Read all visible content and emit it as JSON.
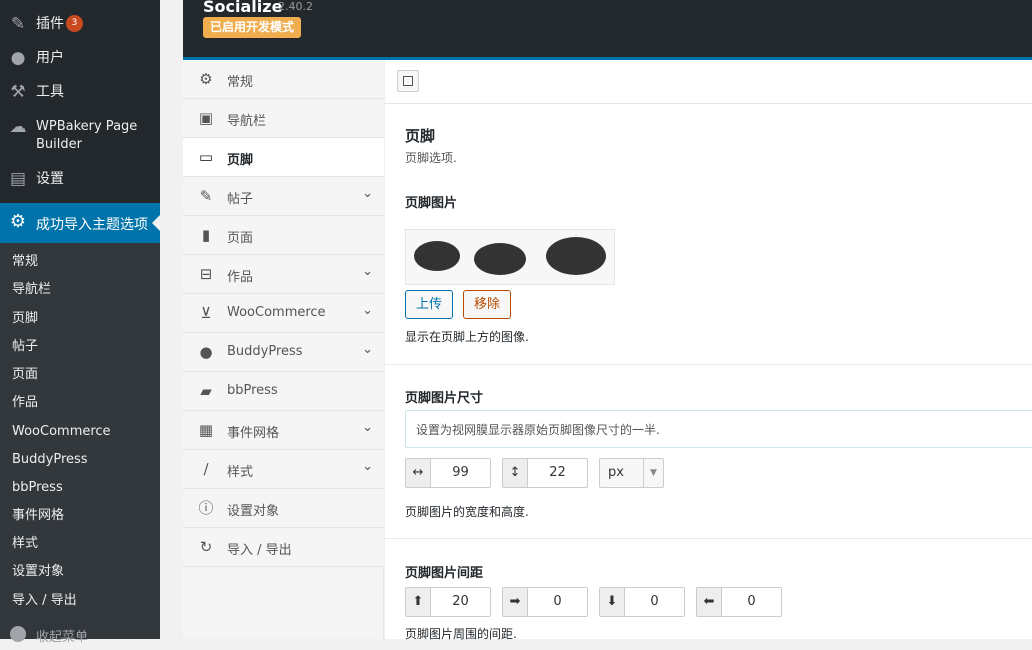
{
  "admin_menu": {
    "items": [
      {
        "label": "插件",
        "icon": "plug-icon",
        "badge": "3"
      },
      {
        "label": "用户",
        "icon": "user-icon"
      },
      {
        "label": "工具",
        "icon": "wrench-icon"
      },
      {
        "label": "WPBakery Page Builder",
        "icon": "speech-bubble-icon"
      },
      {
        "label": "设置",
        "icon": "settings-icon"
      }
    ],
    "current": {
      "label": "成功导入主题选项",
      "icon": "gear-icon"
    },
    "submenu": [
      "常规",
      "导航栏",
      "页脚",
      "帖子",
      "页面",
      "作品",
      "WooCommerce",
      "BuddyPress",
      "bbPress",
      "事件网格",
      "样式",
      "设置对象",
      "导入 / 导出"
    ],
    "collapse_label": "收起菜单"
  },
  "header": {
    "title": "Socialize",
    "version": "2.40.2",
    "dev_mode_badge": "已启用开发模式"
  },
  "tabs": [
    {
      "label": "常规",
      "icon": "gears-icon",
      "has_children": false
    },
    {
      "label": "导航栏",
      "icon": "navbar-icon",
      "has_children": false
    },
    {
      "label": "页脚",
      "icon": "footer-icon",
      "has_children": false,
      "active": true
    },
    {
      "label": "帖子",
      "icon": "pencil-icon",
      "has_children": true
    },
    {
      "label": "页面",
      "icon": "page-icon",
      "has_children": false
    },
    {
      "label": "作品",
      "icon": "portfolio-icon",
      "has_children": true
    },
    {
      "label": "WooCommerce",
      "icon": "cart-icon",
      "has_children": true
    },
    {
      "label": "BuddyPress",
      "icon": "user-icon",
      "has_children": true
    },
    {
      "label": "bbPress",
      "icon": "comments-icon",
      "has_children": false
    },
    {
      "label": "事件网格",
      "icon": "calendar-icon",
      "has_children": true
    },
    {
      "label": "样式",
      "icon": "brush-icon",
      "has_children": true
    },
    {
      "label": "设置对象",
      "icon": "info-icon",
      "has_children": false
    },
    {
      "label": "导入 / 导出",
      "icon": "refresh-icon",
      "has_children": false
    }
  ],
  "main": {
    "section_title": "页脚",
    "section_desc": "页脚选项.",
    "footer_image": {
      "title": "页脚图片",
      "upload_label": "上传",
      "remove_label": "移除",
      "desc": "显示在页脚上方的图像."
    },
    "footer_image_size": {
      "title": "页脚图片尺寸",
      "retina_placeholder": "设置为视网膜显示器原始页脚图像尺寸的一半.",
      "width": "99",
      "height": "22",
      "unit": "px",
      "desc": "页脚图片的宽度和高度."
    },
    "footer_image_spacing": {
      "title": "页脚图片间距",
      "top": "20",
      "right": "0",
      "bottom": "0",
      "left": "0",
      "desc": "页脚图片周围的间距."
    }
  },
  "colors": {
    "admin_bg": "#23282d",
    "accent": "#0073aa",
    "dev_badge": "#f0ad4e",
    "badge": "#ca4a1f"
  }
}
